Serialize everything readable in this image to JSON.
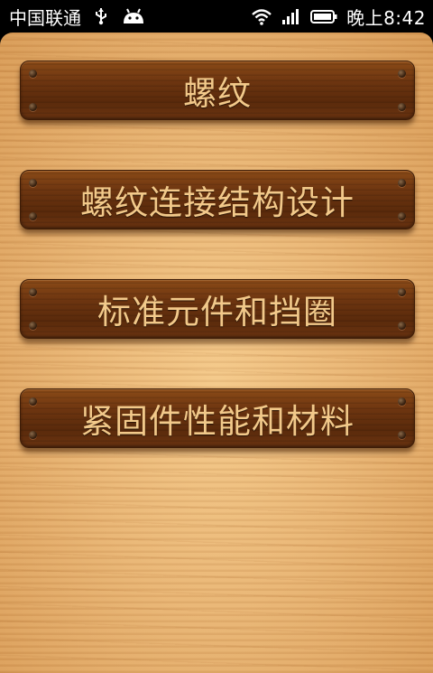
{
  "status_bar": {
    "carrier": "中国联通",
    "time": "晚上8:42",
    "icons": [
      "usb-icon",
      "android-icon",
      "wifi-icon",
      "signal-icon",
      "battery-icon"
    ]
  },
  "menu": {
    "items": [
      {
        "label": "螺纹"
      },
      {
        "label": "螺纹连接结构设计"
      },
      {
        "label": "标准元件和挡圈"
      },
      {
        "label": "紧固件性能和材料"
      }
    ]
  },
  "colors": {
    "plank_text": "#f2c98a",
    "plank_wood": "#6d3510",
    "background_wood": "#e9b574"
  }
}
